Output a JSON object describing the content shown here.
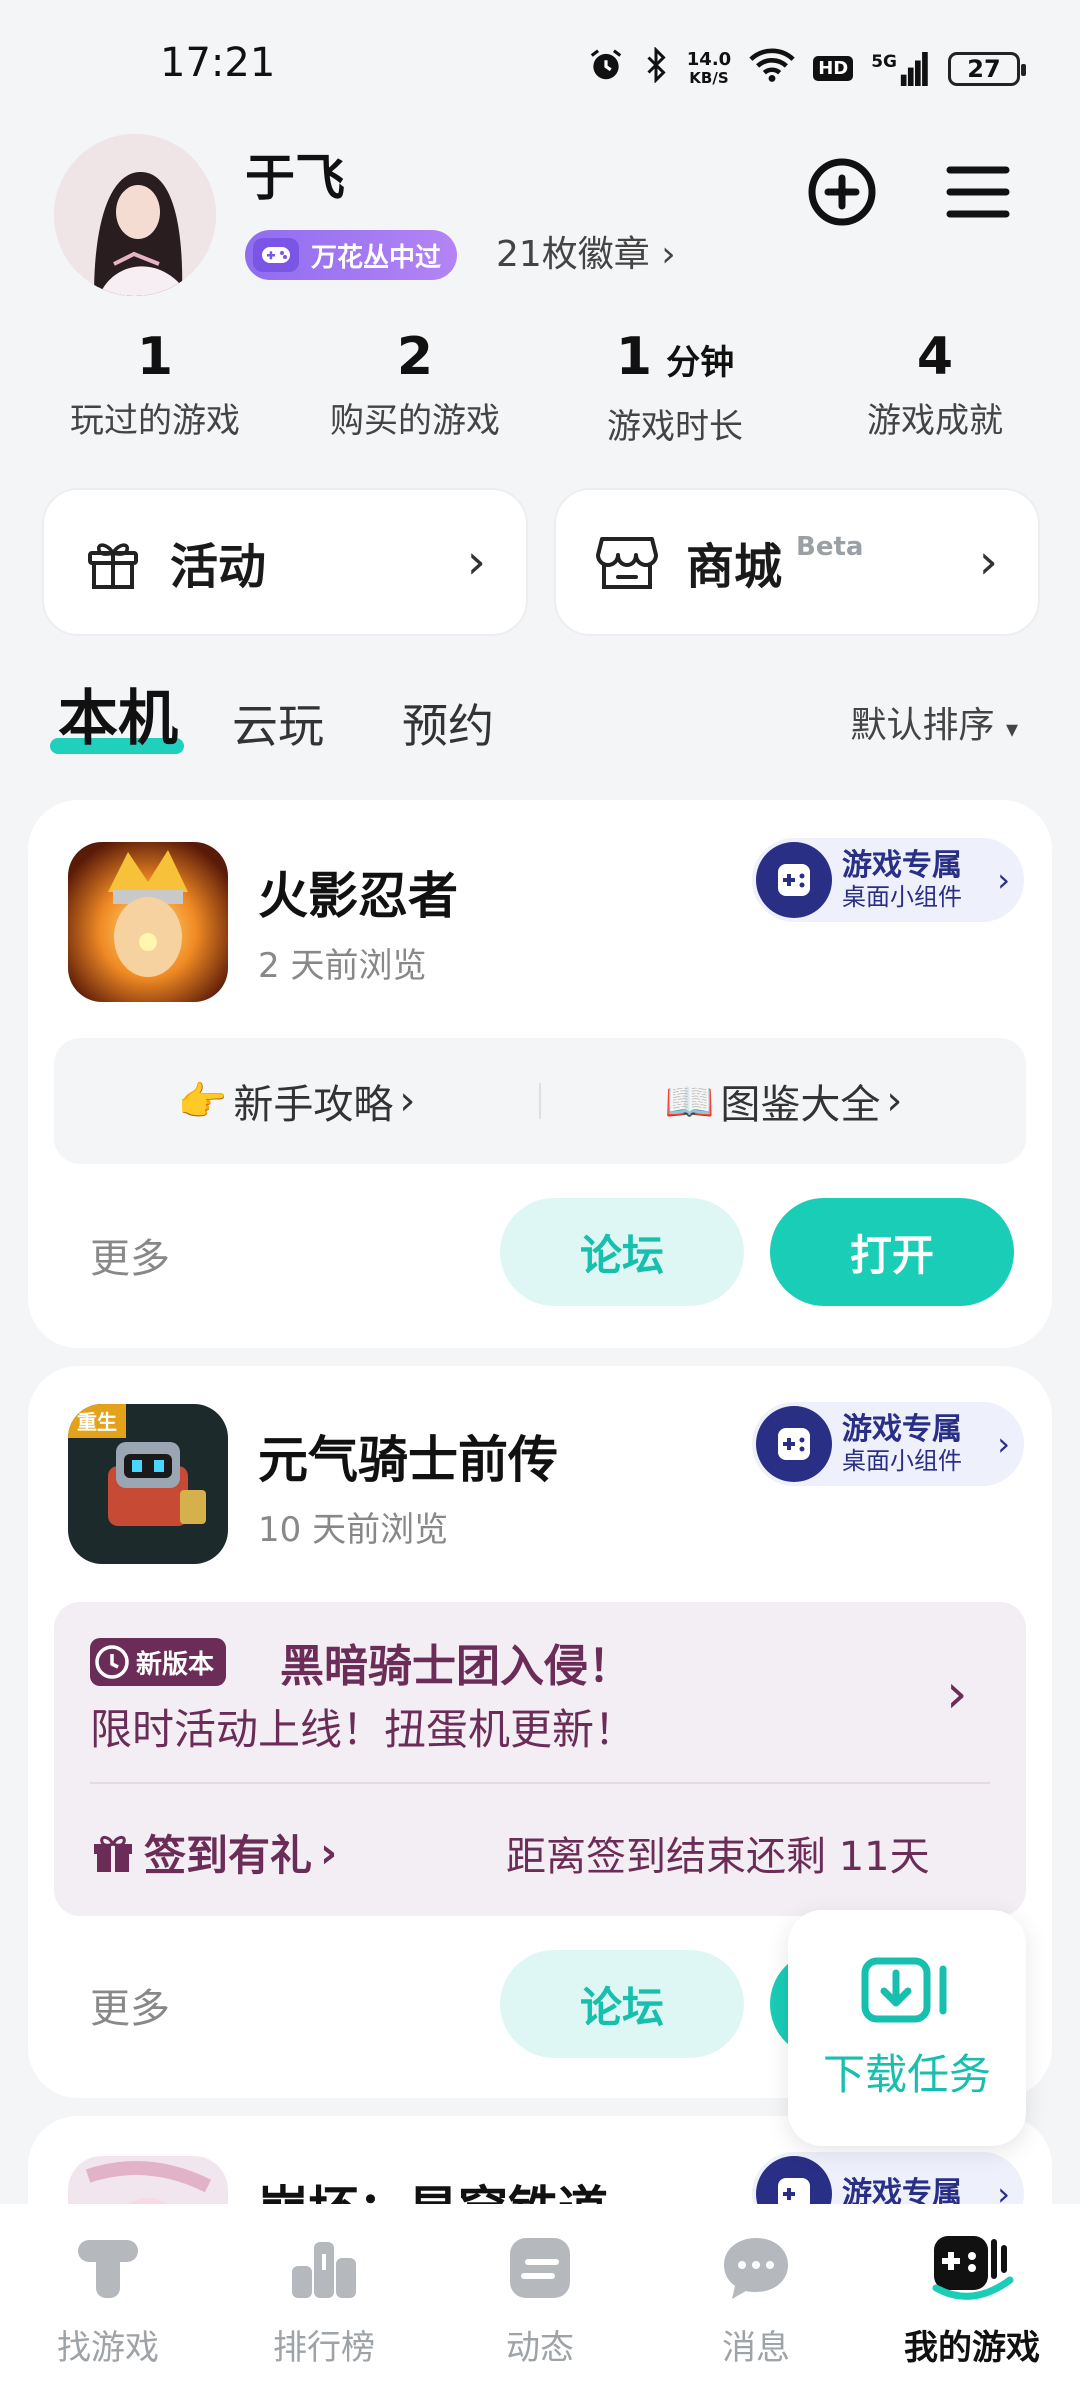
{
  "status_bar": {
    "time": "17:21",
    "net_speed_value": "14.0",
    "net_speed_unit": "KB/S",
    "hd": "HD",
    "signal_label": "5G",
    "battery": "27"
  },
  "profile": {
    "username": "于飞",
    "badge_text": "万花丛中过",
    "badges_count": "21枚徽章",
    "chevron": "›"
  },
  "stats": [
    {
      "value": "1",
      "unit": "",
      "label": "玩过的游戏"
    },
    {
      "value": "2",
      "unit": "",
      "label": "购买的游戏"
    },
    {
      "value": "1",
      "unit": "分钟",
      "label": "游戏时长"
    },
    {
      "value": "4",
      "unit": "",
      "label": "游戏成就"
    }
  ],
  "quick_cards": {
    "activity_label": "活动",
    "store_label": "商城",
    "store_beta": "Beta"
  },
  "tabs": {
    "local": "本机",
    "cloud": "云玩",
    "reserve": "预约",
    "sort": "默认排序"
  },
  "games": [
    {
      "title": "火影忍者",
      "subtitle": "2 天前浏览",
      "widget_title": "游戏专属",
      "widget_sub": "桌面小组件",
      "guide_left": "新手攻略",
      "guide_right": "图鉴大全",
      "more": "更多",
      "forum": "论坛",
      "open": "打开"
    },
    {
      "title": "元气骑士前传",
      "subtitle": "10 天前浏览",
      "widget_title": "游戏专属",
      "widget_sub": "桌面小组件",
      "new_tag": "新版本",
      "event_title": "黑暗骑士团入侵！",
      "event_desc": "限时活动上线！扭蛋机更新！",
      "sign_label": "签到有礼",
      "remain": "距离签到结束还剩 11天",
      "more": "更多",
      "forum": "论坛",
      "icon_tag": "重生"
    },
    {
      "title": "崩坏：星穹铁道",
      "widget_title": "游戏专属"
    }
  ],
  "download_float": {
    "label": "下载任务"
  },
  "bottom_nav": [
    {
      "label": "找游戏"
    },
    {
      "label": "排行榜"
    },
    {
      "label": "动态"
    },
    {
      "label": "消息"
    },
    {
      "label": "我的游戏"
    }
  ],
  "colors": {
    "accent": "#19cdb7",
    "widget": "#2a2f86",
    "event": "#6b2d58",
    "badge": "#8f6df0"
  }
}
